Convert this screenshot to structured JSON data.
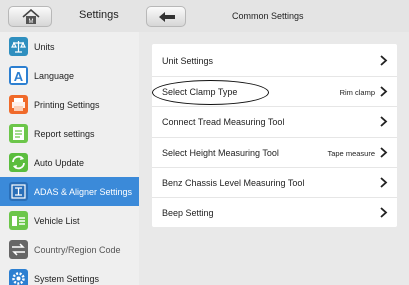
{
  "header": {
    "left_title": "Settings",
    "right_title": "Common Settings",
    "home_icon": "home-icon",
    "back_icon": "back-arrow-icon"
  },
  "sidebar": {
    "items": [
      {
        "label": "Units",
        "icon": "scale-icon",
        "color": "#2f8fbf"
      },
      {
        "label": "Language",
        "icon": "letter-a-icon",
        "color": "#2c7fd1"
      },
      {
        "label": "Printing Settings",
        "icon": "printer-icon",
        "color": "#f06a2a"
      },
      {
        "label": "Report settings",
        "icon": "report-icon",
        "color": "#6cc64a"
      },
      {
        "label": "Auto Update",
        "icon": "update-icon",
        "color": "#5bbd3e"
      },
      {
        "label": "ADAS & Aligner Settings",
        "icon": "adas-icon",
        "color": "#3b8ad9",
        "active": true
      },
      {
        "label": "Vehicle List",
        "icon": "vehicle-list-icon",
        "color": "#6cc64a"
      },
      {
        "label": "Country/Region Code",
        "icon": "swap-arrows-icon",
        "color": "#666666"
      },
      {
        "label": "System Settings",
        "icon": "gear-icon",
        "color": "#2c7fd1"
      }
    ]
  },
  "main": {
    "rows": [
      {
        "label": "Unit Settings",
        "value": ""
      },
      {
        "label": "Select Clamp Type",
        "value": "Rim clamp"
      },
      {
        "label": "Connect Tread Measuring Tool",
        "value": ""
      },
      {
        "label": "Select Height Measuring Tool",
        "value": "Tape measure"
      },
      {
        "label": "Benz Chassis Level Measuring Tool",
        "value": ""
      },
      {
        "label": "Beep Setting",
        "value": ""
      }
    ]
  },
  "colors": {
    "accent": "#3b8ad9",
    "sidebar_bg": "#efefef",
    "main_bg": "#e9e9e9"
  }
}
